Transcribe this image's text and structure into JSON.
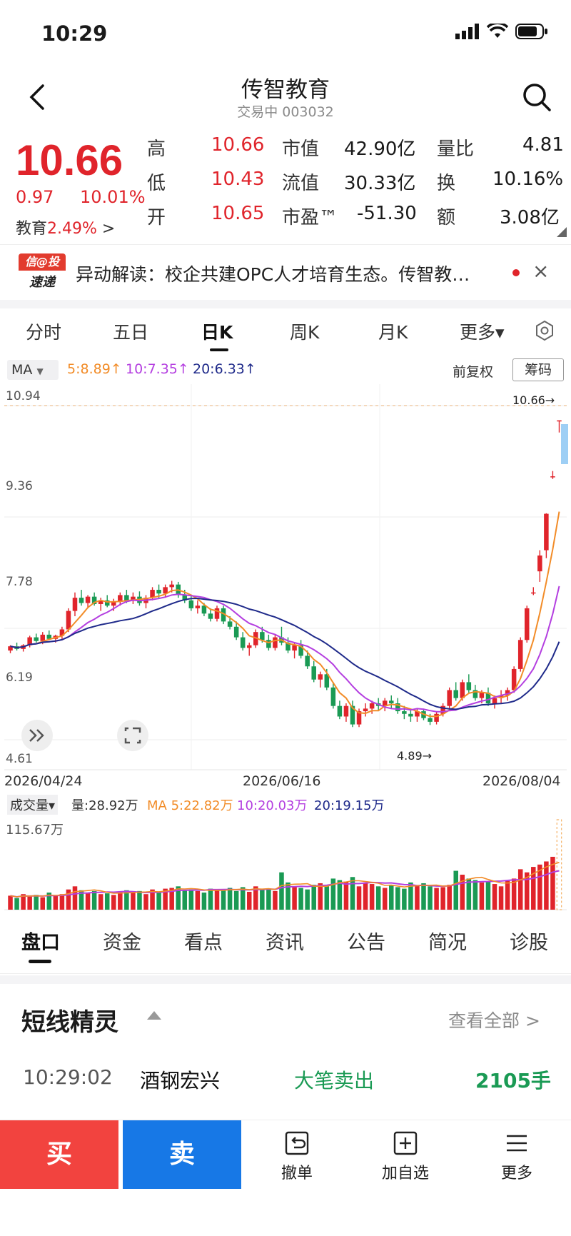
{
  "status": {
    "time": "10:29"
  },
  "header": {
    "title": "传智教育",
    "subtitle": "交易中 003032"
  },
  "quote": {
    "price": "10.66",
    "change": "0.97",
    "change_pct": "10.01%",
    "sector_name": "教育",
    "sector_pct": "2.49%",
    "sector_arrow": ">",
    "stats": [
      {
        "label": "高",
        "value": "10.66"
      },
      {
        "label": "低",
        "value": "10.43"
      },
      {
        "label": "开",
        "value": "10.65"
      },
      {
        "label": "市值",
        "value": "42.90亿"
      },
      {
        "label": "流值",
        "value": "30.33亿"
      },
      {
        "label": "市盈™",
        "value": "-51.30"
      },
      {
        "label": "量比",
        "value": "4.81"
      },
      {
        "label": "换",
        "value": "10.16%"
      },
      {
        "label": "额",
        "value": "3.08亿"
      }
    ]
  },
  "news": {
    "logo_top": "信@投",
    "logo_bottom": "速递",
    "text": "异动解读：校企共建OPC人才培育生态。传智教…",
    "close": "×"
  },
  "ktabs": [
    "分时",
    "五日",
    "日K",
    "周K",
    "月K",
    "更多▾"
  ],
  "ma": {
    "label": "MA",
    "ma5": "5:8.89↑",
    "ma10": "10:7.35↑",
    "ma20": "20:6.33↑",
    "fq": "前复权",
    "chip": "筹码"
  },
  "kchart": {
    "y_labels": [
      "10.94",
      "9.36",
      "7.78",
      "6.19",
      "4.61"
    ],
    "x_labels": [
      "2026/04/24",
      "2026/06/16",
      "2026/08/04"
    ],
    "high_marker": "10.66→",
    "low_marker": "4.89→"
  },
  "vol": {
    "label": "成交量▾",
    "vol": "量:28.92万",
    "ma5": "MA 5:22.82万",
    "ma10": "10:20.03万",
    "ma20": "20:19.15万",
    "max_label": "115.67万"
  },
  "chart_data": {
    "type": "candlestick",
    "ylim": [
      4.61,
      10.94
    ],
    "y_ticks": [
      "10.94",
      "9.36",
      "7.78",
      "6.19",
      "4.61"
    ],
    "x_ticks": [
      "2026/04/24",
      "2026/06/16",
      "2026/08/04"
    ],
    "ohlc": [
      [
        6.3,
        6.4,
        6.25,
        6.38
      ],
      [
        6.38,
        6.45,
        6.3,
        6.33
      ],
      [
        6.33,
        6.42,
        6.28,
        6.4
      ],
      [
        6.4,
        6.58,
        6.36,
        6.55
      ],
      [
        6.55,
        6.62,
        6.45,
        6.48
      ],
      [
        6.48,
        6.65,
        6.42,
        6.6
      ],
      [
        6.6,
        6.68,
        6.5,
        6.52
      ],
      [
        6.52,
        6.6,
        6.45,
        6.58
      ],
      [
        6.58,
        6.75,
        6.52,
        6.7
      ],
      [
        6.7,
        7.1,
        6.65,
        7.05
      ],
      [
        7.05,
        7.4,
        6.95,
        7.3
      ],
      [
        7.3,
        7.45,
        7.15,
        7.2
      ],
      [
        7.2,
        7.35,
        7.1,
        7.32
      ],
      [
        7.32,
        7.4,
        7.15,
        7.18
      ],
      [
        7.18,
        7.3,
        7.05,
        7.25
      ],
      [
        7.25,
        7.35,
        7.12,
        7.15
      ],
      [
        7.15,
        7.28,
        7.05,
        7.22
      ],
      [
        7.22,
        7.4,
        7.15,
        7.35
      ],
      [
        7.35,
        7.45,
        7.2,
        7.25
      ],
      [
        7.25,
        7.4,
        7.18,
        7.32
      ],
      [
        7.32,
        7.42,
        7.15,
        7.2
      ],
      [
        7.2,
        7.35,
        7.1,
        7.3
      ],
      [
        7.3,
        7.5,
        7.25,
        7.45
      ],
      [
        7.45,
        7.55,
        7.3,
        7.38
      ],
      [
        7.38,
        7.55,
        7.3,
        7.5
      ],
      [
        7.5,
        7.62,
        7.4,
        7.55
      ],
      [
        7.55,
        7.6,
        7.3,
        7.35
      ],
      [
        7.35,
        7.45,
        7.2,
        7.25
      ],
      [
        7.25,
        7.35,
        7.05,
        7.1
      ],
      [
        7.1,
        7.25,
        7.0,
        7.15
      ],
      [
        7.15,
        7.2,
        6.95,
        7.0
      ],
      [
        7.0,
        7.1,
        6.85,
        6.9
      ],
      [
        6.9,
        7.15,
        6.85,
        7.1
      ],
      [
        7.1,
        7.15,
        6.8,
        6.85
      ],
      [
        6.85,
        6.95,
        6.7,
        6.75
      ],
      [
        6.75,
        6.85,
        6.5,
        6.55
      ],
      [
        6.55,
        6.65,
        6.3,
        6.35
      ],
      [
        6.35,
        6.45,
        6.2,
        6.4
      ],
      [
        6.4,
        6.7,
        6.35,
        6.65
      ],
      [
        6.65,
        6.75,
        6.45,
        6.5
      ],
      [
        6.5,
        6.6,
        6.3,
        6.35
      ],
      [
        6.35,
        6.6,
        6.3,
        6.55
      ],
      [
        6.55,
        6.75,
        6.4,
        6.45
      ],
      [
        6.45,
        6.55,
        6.25,
        6.3
      ],
      [
        6.3,
        6.45,
        6.15,
        6.4
      ],
      [
        6.4,
        6.5,
        6.15,
        6.2
      ],
      [
        6.2,
        6.3,
        5.95,
        6.0
      ],
      [
        6.0,
        6.1,
        5.7,
        5.75
      ],
      [
        5.75,
        5.9,
        5.6,
        5.85
      ],
      [
        5.85,
        5.95,
        5.55,
        5.6
      ],
      [
        5.6,
        5.7,
        5.2,
        5.25
      ],
      [
        5.25,
        5.35,
        5.0,
        5.05
      ],
      [
        5.05,
        5.3,
        4.95,
        5.25
      ],
      [
        5.25,
        5.35,
        4.85,
        4.9
      ],
      [
        4.9,
        5.2,
        4.85,
        5.15
      ],
      [
        5.15,
        5.3,
        5.05,
        5.2
      ],
      [
        5.2,
        5.35,
        5.1,
        5.3
      ],
      [
        5.3,
        5.4,
        5.15,
        5.25
      ],
      [
        5.25,
        5.4,
        5.15,
        5.35
      ],
      [
        5.35,
        5.45,
        5.2,
        5.3
      ],
      [
        5.3,
        5.4,
        5.1,
        5.15
      ],
      [
        5.15,
        5.25,
        5.0,
        5.1
      ],
      [
        5.1,
        5.2,
        4.95,
        5.05
      ],
      [
        5.05,
        5.2,
        4.95,
        5.15
      ],
      [
        5.15,
        5.2,
        4.98,
        5.02
      ],
      [
        5.02,
        5.1,
        4.89,
        4.95
      ],
      [
        4.95,
        5.15,
        4.9,
        5.1
      ],
      [
        5.1,
        5.3,
        5.05,
        5.25
      ],
      [
        5.25,
        5.6,
        5.2,
        5.55
      ],
      [
        5.55,
        5.7,
        5.35,
        5.4
      ],
      [
        5.4,
        5.75,
        5.35,
        5.7
      ],
      [
        5.7,
        5.85,
        5.5,
        5.55
      ],
      [
        5.55,
        5.65,
        5.35,
        5.4
      ],
      [
        5.4,
        5.55,
        5.3,
        5.5
      ],
      [
        5.5,
        5.6,
        5.25,
        5.3
      ],
      [
        5.3,
        5.45,
        5.2,
        5.4
      ],
      [
        5.4,
        5.55,
        5.3,
        5.45
      ],
      [
        5.45,
        5.6,
        5.35,
        5.55
      ],
      [
        5.55,
        6.0,
        5.5,
        5.95
      ],
      [
        5.95,
        6.55,
        5.9,
        6.5
      ],
      [
        6.5,
        7.15,
        6.45,
        7.1
      ],
      [
        7.4,
        7.5,
        7.35,
        7.4
      ],
      [
        7.8,
        8.2,
        7.6,
        8.1
      ],
      [
        8.2,
        8.9,
        8.05,
        8.89
      ],
      [
        9.6,
        9.7,
        9.55,
        9.6
      ],
      [
        10.65,
        10.66,
        10.43,
        10.66
      ]
    ],
    "ma5_end": 8.89,
    "ma10_end": 7.35,
    "ma20_end": 6.33,
    "volume": [
      18,
      15,
      20,
      17,
      19,
      16,
      22,
      18,
      20,
      26,
      30,
      25,
      22,
      24,
      20,
      21,
      19,
      23,
      25,
      22,
      24,
      20,
      26,
      23,
      27,
      28,
      30,
      25,
      26,
      24,
      22,
      27,
      26,
      25,
      28,
      24,
      29,
      23,
      30,
      26,
      27,
      24,
      48,
      35,
      30,
      28,
      26,
      32,
      34,
      30,
      40,
      38,
      36,
      42,
      30,
      35,
      33,
      30,
      28,
      32,
      29,
      27,
      35,
      31,
      34,
      30,
      28,
      29,
      32,
      50,
      45,
      40,
      38,
      35,
      36,
      33,
      30,
      37,
      40,
      52,
      48,
      55,
      58,
      62,
      68,
      115.67
    ],
    "volume_max": "115.67万"
  },
  "btabs": [
    "盘口",
    "资金",
    "看点",
    "资讯",
    "公告",
    "简况",
    "诊股"
  ],
  "spirit": {
    "title": "短线精灵",
    "view_all": "查看全部 >",
    "row": {
      "time": "10:29:02",
      "name": "酒钢宏兴",
      "action": "大笔卖出",
      "qty": "2105手"
    }
  },
  "bottom": {
    "buy": "买",
    "sell": "卖",
    "cancel": "撤单",
    "add": "加自选",
    "more": "更多"
  },
  "colors": {
    "up": "#e0242b",
    "down": "#1a9a54",
    "ma5": "#f28c28",
    "ma10": "#b43fe0",
    "ma20": "#1f2a8a"
  }
}
